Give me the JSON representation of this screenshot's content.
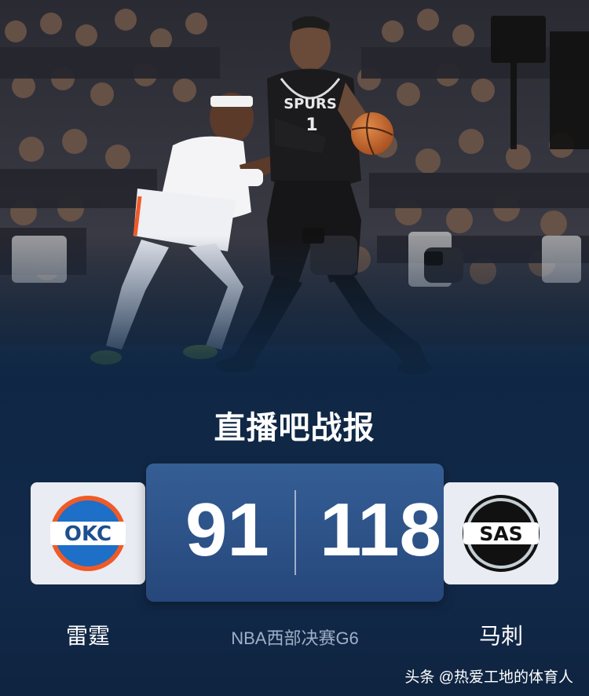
{
  "brand": {
    "title": "直播吧战报"
  },
  "match": {
    "home_team": {
      "name": "雷霆",
      "logo_text": "OKC",
      "score": "91",
      "colors": {
        "primary": "#1d6fc7",
        "secondary": "#f05a28"
      }
    },
    "away_team": {
      "name": "马刺",
      "logo_text": "SAS",
      "score": "118",
      "colors": {
        "primary": "#111111",
        "secondary": "#c4ced4"
      }
    },
    "info": "NBA西部决赛G6"
  },
  "photo": {
    "jersey_text": "SPURS",
    "jersey_number": "1"
  },
  "watermark": "头条 @热爱工地的体育人",
  "colors": {
    "background": "#0f2744",
    "score_box": "#2d5389",
    "card": "#e9ecf2"
  }
}
